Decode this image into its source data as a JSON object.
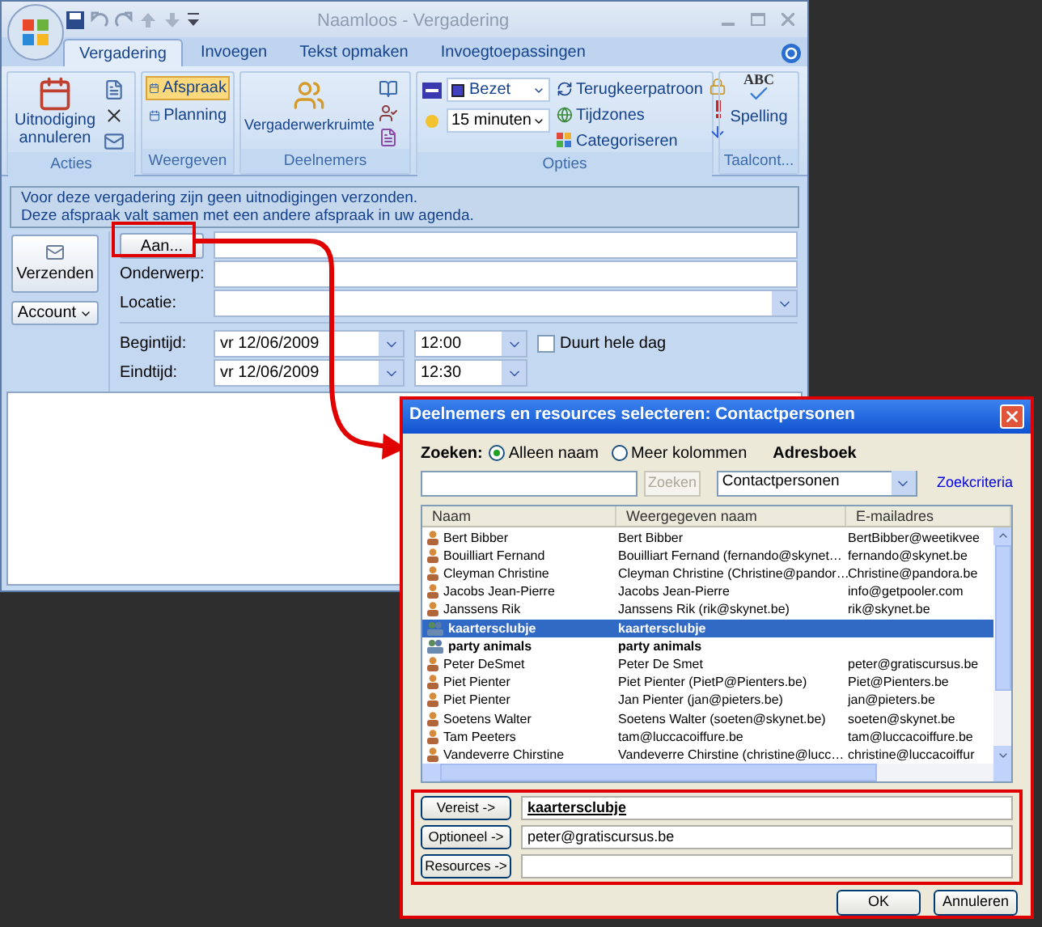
{
  "window": {
    "title": "Naamloos - Vergadering"
  },
  "tabs": [
    {
      "label": "Vergadering",
      "selected": true
    },
    {
      "label": "Invoegen",
      "selected": false
    },
    {
      "label": "Tekst opmaken",
      "selected": false
    },
    {
      "label": "Invoegtoepassingen",
      "selected": false
    }
  ],
  "ribbon": {
    "acties": {
      "label": "Acties",
      "cancel_button": "Uitnodiging annuleren"
    },
    "weergeven": {
      "label": "Weergeven",
      "items": [
        {
          "label": "Afspraak",
          "selected": true
        },
        {
          "label": "Planning",
          "selected": false
        }
      ]
    },
    "deelnemers": {
      "label": "Deelnemers",
      "button": "Vergaderwerkruimte"
    },
    "opties": {
      "label": "Opties",
      "show_as": "Bezet",
      "reminder": "15 minuten",
      "commands": [
        "Terugkeerpatroon",
        "Tijdzones",
        "Categoriseren"
      ]
    },
    "taal": {
      "label": "Taalcont...",
      "icon_text": "ABC",
      "button": "Spelling"
    }
  },
  "info_bar": [
    "Voor deze vergadering zijn geen uitnodigingen verzonden.",
    "Deze afspraak valt samen met een andere afspraak in uw agenda."
  ],
  "send_button": "Verzenden",
  "account_button": "Account",
  "to_button": "Aan...",
  "fields": {
    "subject_label": "Onderwerp:",
    "location_label": "Locatie:",
    "start_label": "Begintijd:",
    "start_date": "vr 12/06/2009",
    "start_time": "12:00",
    "all_day": {
      "label": "Duurt hele dag",
      "checked": false
    },
    "end_label": "Eindtijd:",
    "end_date": "vr 12/06/2009",
    "end_time": "12:30"
  },
  "dialog": {
    "title": "Deelnemers en resources selecteren: Contactpersonen",
    "search_label": "Zoeken:",
    "search_modes": [
      {
        "label": "Alleen naam",
        "selected": true
      },
      {
        "label": "Meer kolommen",
        "selected": false
      }
    ],
    "addressbook_label": "Adresboek",
    "search_button": {
      "label": "Zoeken",
      "disabled": true
    },
    "addressbook": "Contactpersonen",
    "criteria_link": "Zoekcriteria",
    "columns": [
      "Naam",
      "Weergegeven naam",
      "E-mailadres"
    ],
    "contacts": [
      {
        "kind": "person",
        "name": "Bert Bibber",
        "display": "Bert Bibber",
        "email": "BertBibber@weetikvee",
        "selected": false
      },
      {
        "kind": "person",
        "name": "Bouilliart Fernand",
        "display": "Bouilliart Fernand (fernando@skynet…",
        "email": "fernando@skynet.be",
        "selected": false
      },
      {
        "kind": "person",
        "name": "Cleyman Christine",
        "display": "Cleyman Christine (Christine@pandor…",
        "email": "Christine@pandora.be",
        "selected": false
      },
      {
        "kind": "person",
        "name": "Jacobs Jean-Pierre",
        "display": "Jacobs Jean-Pierre",
        "email": "info@getpooler.com",
        "selected": false
      },
      {
        "kind": "person",
        "name": "Janssens Rik",
        "display": "Janssens Rik (rik@skynet.be)",
        "email": "rik@skynet.be",
        "selected": false
      },
      {
        "kind": "group",
        "name": "kaartersclubje",
        "display": "kaartersclubje",
        "selected": true
      },
      {
        "kind": "group",
        "name": "party animals",
        "display": "party animals",
        "selected": false
      },
      {
        "kind": "person",
        "name": "Peter DeSmet",
        "display": "Peter De Smet",
        "email": "peter@gratiscursus.be",
        "selected": false
      },
      {
        "kind": "person",
        "name": "Piet Pienter",
        "display": "Piet Pienter (PietP@Pienters.be)",
        "email": "Piet@Pienters.be",
        "selected": false
      },
      {
        "kind": "person",
        "name": "Piet Pienter",
        "display": "Jan Pienter (jan@pieters.be)",
        "email": "jan@pieters.be",
        "selected": false
      },
      {
        "kind": "person",
        "name": "Soetens Walter",
        "display": "Soetens Walter (soeten@skynet.be)",
        "email": "soeten@skynet.be",
        "selected": false
      },
      {
        "kind": "person",
        "name": "Tam Peeters",
        "display": "tam@luccacoiffure.be",
        "email": "tam@luccacoiffure.be",
        "selected": false
      },
      {
        "kind": "person",
        "name": "Vandeverre Chirstine",
        "display": "Vandeverre Chirstine (christine@lucc…",
        "email": "christine@luccacoiffur",
        "selected": false
      }
    ],
    "recipients": [
      {
        "button": "Vereist ->",
        "value": "kaartersclubje",
        "resolved": true
      },
      {
        "button": "Optioneel ->",
        "value": "peter@gratiscursus.be",
        "resolved": false
      },
      {
        "button": "Resources ->"
      }
    ],
    "buttons": [
      "OK",
      "Annuleren"
    ]
  }
}
